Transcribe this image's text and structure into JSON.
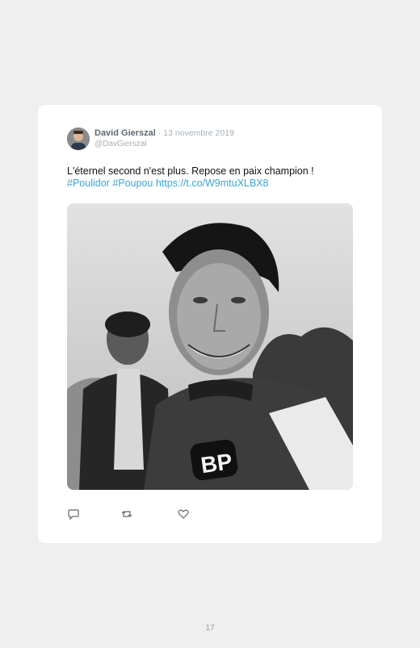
{
  "tweet": {
    "author_name": "David Gierszal",
    "date": "· 13 novembre 2019",
    "handle": "@DavGierszal",
    "text": "L'éternel second n'est plus. Repose en paix champion !",
    "hashtag1": "#Poulidor",
    "hashtag2": "#Poupou",
    "url": "https://t.co/W9mtuXLBX8",
    "photo_badge_text": "BP",
    "link_color": "#3ba4d8"
  },
  "actions": {
    "reply_icon": "reply-icon",
    "retweet_icon": "retweet-icon",
    "like_icon": "heart-icon"
  },
  "page": {
    "number": "17"
  }
}
